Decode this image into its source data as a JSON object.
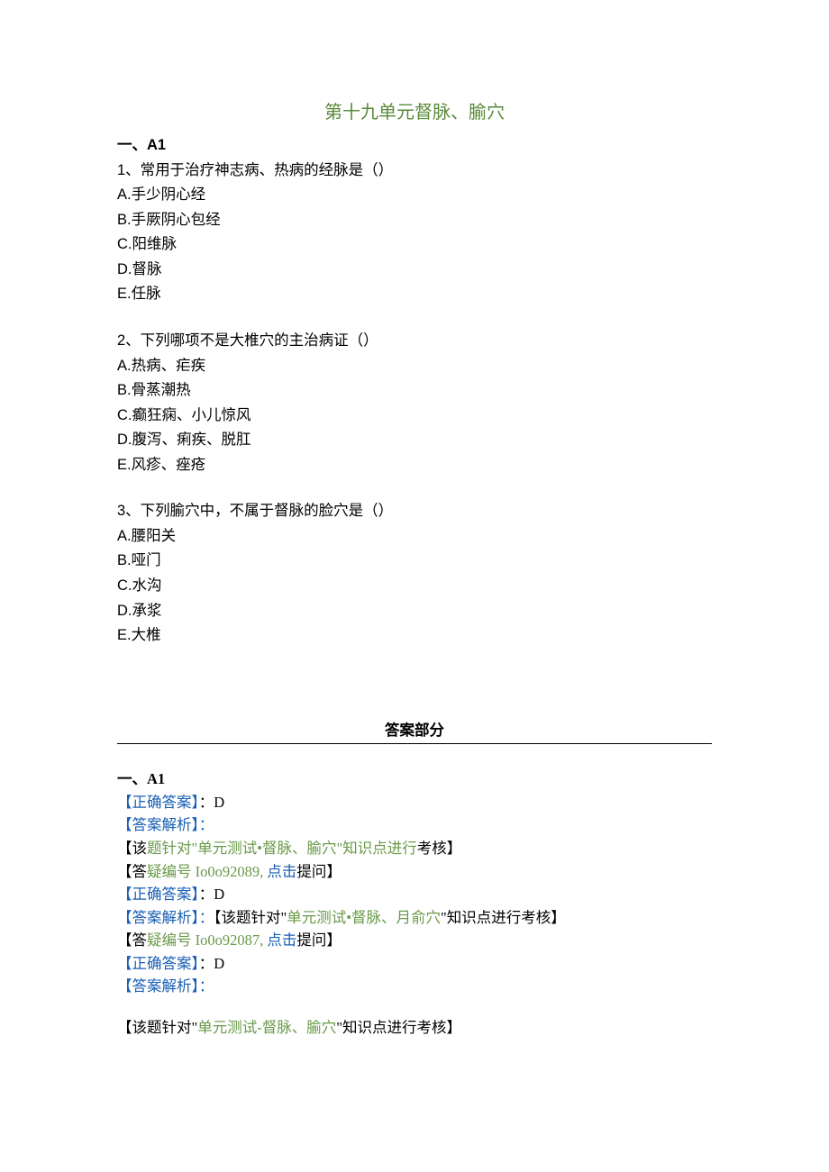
{
  "title": "第十九单元督脉、腧穴",
  "section_a1": "一、A1",
  "questions": [
    {
      "stem": "1、常用于治疗神志病、热病的经脉是（）",
      "options": [
        "A.手少阴心经",
        "B.手厥阴心包经",
        "C.阳维脉",
        "D.督脉",
        "E.任脉"
      ]
    },
    {
      "stem": "2、下列哪项不是大椎穴的主治病证（）",
      "options": [
        "A.热病、疟疾",
        "B.骨蒸潮热",
        "C.癫狂痫、小儿惊风",
        "D.腹泻、痢疾、脱肛",
        "E.风疹、痤疮"
      ]
    },
    {
      "stem": "3、下列腧穴中，不属于督脉的脸穴是（）",
      "options": [
        "A.腰阳关",
        "B.哑门",
        "C.水沟",
        "D.承浆",
        "E.大椎"
      ]
    }
  ],
  "answers_header": "答案部分",
  "answers_section_a1": "一、A1",
  "ans": {
    "label_correct_open": "【正确答案】",
    "label_analysis_open": "【答案解析】",
    "label_analysis_open2": "【答案解析】：",
    "colon_d": "：D",
    "colon": "：",
    "a1": {
      "note_prefix": "【该",
      "note_mid1": "题针对\"",
      "note_green": "单元测试•督脉、腧穴",
      "note_suffix": "\"知识点进行",
      "note_end": "考核】",
      "yida_prefix": "【答",
      "yida_mid": "疑编号 Io0o92089, ",
      "yida_link": "点击",
      "yida_suffix": "提问】"
    },
    "a2": {
      "analysis_full_prefix": "【该题针对\"",
      "analysis_green": "单元测试•督脉、月俞穴",
      "analysis_suffix": "\"知识点进行考核】",
      "yida_prefix": "【答",
      "yida_mid": "疑编号 Io0o92087, ",
      "yida_link": "点击",
      "yida_suffix": "提问】"
    },
    "a3": {
      "note_prefix": "【该题针对\"",
      "note_green": "单元测试-督脉、腧穴",
      "note_suffix": "\"知识点进行考核】"
    }
  }
}
